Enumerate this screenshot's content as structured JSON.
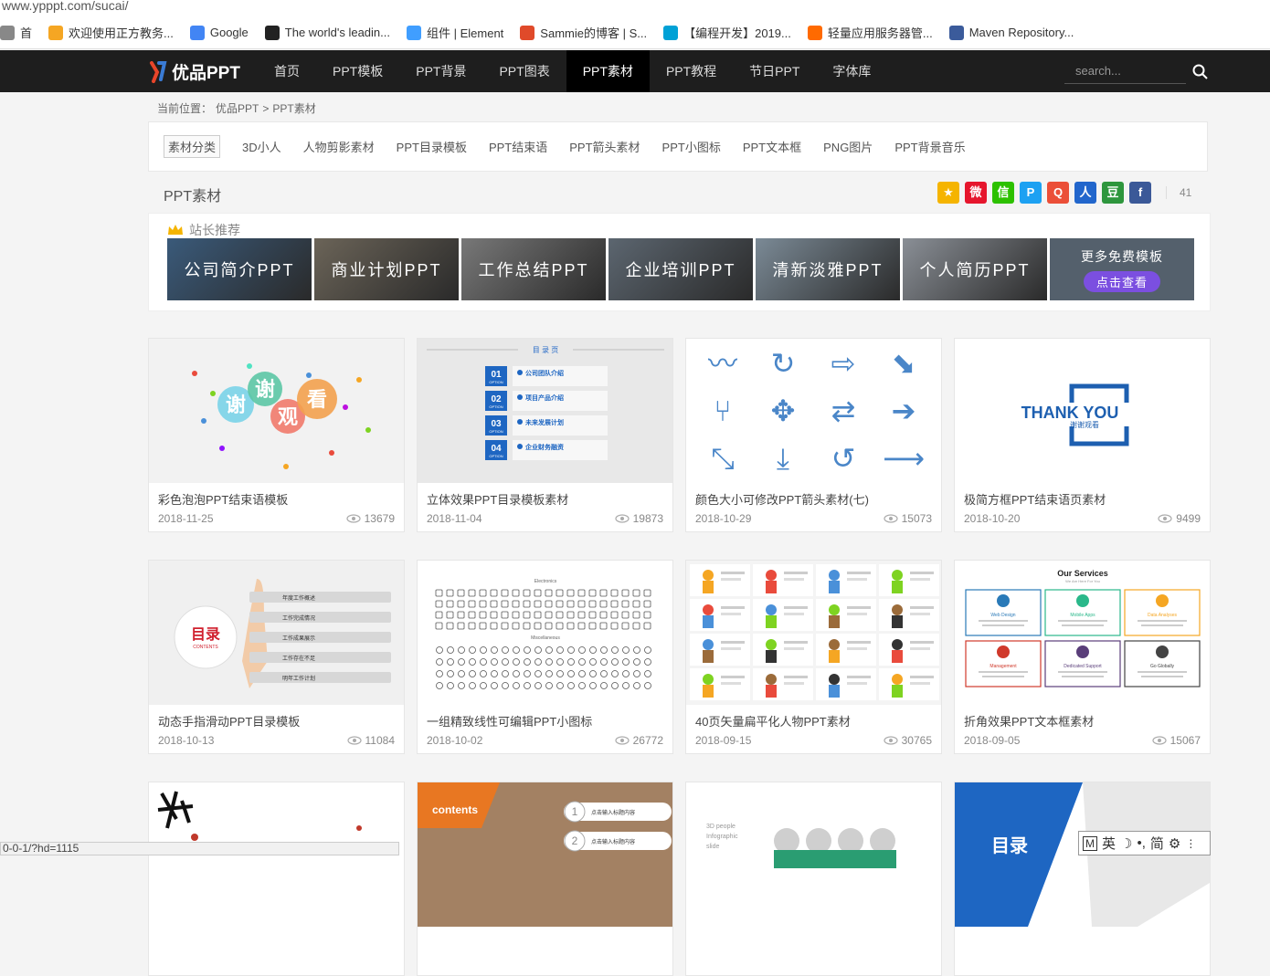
{
  "browser": {
    "url": "www.ypppt.com/sucai/",
    "bookmarks": [
      {
        "label": "首",
        "icon": "page-icon",
        "color": "#888888"
      },
      {
        "label": "欢迎使用正方教务...",
        "icon": "ep-icon",
        "color": "#f5a623"
      },
      {
        "label": "Google",
        "icon": "google-icon",
        "color": "#4285f4"
      },
      {
        "label": "The world's leadin...",
        "icon": "github-icon",
        "color": "#222222"
      },
      {
        "label": "组件 | Element",
        "icon": "element-icon",
        "color": "#409eff"
      },
      {
        "label": "Sammie的博客 | S...",
        "icon": "tomato-icon",
        "color": "#e04a2a"
      },
      {
        "label": "【编程开发】2019...",
        "icon": "bilibili-icon",
        "color": "#00a1d6"
      },
      {
        "label": "轻量应用服务器管...",
        "icon": "aliyun-icon",
        "color": "#ff6a00"
      },
      {
        "label": "Maven Repository...",
        "icon": "maven-icon",
        "color": "#3b5b9b"
      }
    ],
    "status_url": "0-0-1/?hd=1115"
  },
  "site": {
    "logo_text": "优品PPT",
    "nav": [
      "首页",
      "PPT模板",
      "PPT背景",
      "PPT图表",
      "PPT素材",
      "PPT教程",
      "节日PPT",
      "字体库"
    ],
    "active_nav": 4,
    "search_placeholder": "search..."
  },
  "breadcrumb": {
    "prefix": "当前位置：",
    "home": "优品PPT",
    "sep": ">",
    "current": "PPT素材"
  },
  "categories": [
    "素材分类",
    "3D小人",
    "人物剪影素材",
    "PPT目录模板",
    "PPT结束语",
    "PPT箭头素材",
    "PPT小图标",
    "PPT文本框",
    "PNG图片",
    "PPT背景音乐"
  ],
  "section_title": "PPT素材",
  "share": {
    "icons": [
      {
        "name": "qzone-icon",
        "color": "#f5b400",
        "glyph": "★"
      },
      {
        "name": "weibo-icon",
        "color": "#e6162d",
        "glyph": "微"
      },
      {
        "name": "wechat-icon",
        "color": "#2dc100",
        "glyph": "信"
      },
      {
        "name": "tqq-icon",
        "color": "#1da1f2",
        "glyph": "P"
      },
      {
        "name": "qq-icon",
        "color": "#eb4f38",
        "glyph": "Q"
      },
      {
        "name": "renren-icon",
        "color": "#2266cc",
        "glyph": "人"
      },
      {
        "name": "douban-icon",
        "color": "#2e963d",
        "glyph": "豆"
      },
      {
        "name": "facebook-icon",
        "color": "#3b5998",
        "glyph": "f"
      }
    ],
    "count": "41"
  },
  "recommend": {
    "title": "站长推荐",
    "banners": [
      {
        "label": "公司简介PPT",
        "color": "#3a5a7a"
      },
      {
        "label": "商业计划PPT",
        "color": "#6b6458"
      },
      {
        "label": "工作总结PPT",
        "color": "#787878"
      },
      {
        "label": "企业培训PPT",
        "color": "#5c6670"
      },
      {
        "label": "清新淡雅PPT",
        "color": "#7b8a96"
      },
      {
        "label": "个人简历PPT",
        "color": "#8a8f96"
      }
    ],
    "more": {
      "label": "更多免费模板",
      "button": "点击查看",
      "color": "#54606c"
    }
  },
  "items": [
    {
      "title": "彩色泡泡PPT结束语模板",
      "date": "2018-11-25",
      "views": "13679",
      "thumb": "bubbles"
    },
    {
      "title": "立体效果PPT目录模板素材",
      "date": "2018-11-04",
      "views": "19873",
      "thumb": "toc"
    },
    {
      "title": "颜色大小可修改PPT箭头素材(七)",
      "date": "2018-10-29",
      "views": "15073",
      "thumb": "arrows"
    },
    {
      "title": "极简方框PPT结束语页素材",
      "date": "2018-10-20",
      "views": "9499",
      "thumb": "thankyou"
    },
    {
      "title": "动态手指滑动PPT目录模板",
      "date": "2018-10-13",
      "views": "11084",
      "thumb": "finger"
    },
    {
      "title": "一组精致线性可编辑PPT小图标",
      "date": "2018-10-02",
      "views": "26772",
      "thumb": "icons"
    },
    {
      "title": "40页矢量扁平化人物PPT素材",
      "date": "2018-09-15",
      "views": "30765",
      "thumb": "people"
    },
    {
      "title": "折角效果PPT文本框素材",
      "date": "2018-09-05",
      "views": "15067",
      "thumb": "services"
    },
    {
      "title": "",
      "date": "",
      "views": "",
      "thumb": "calligraphy"
    },
    {
      "title": "",
      "date": "",
      "views": "",
      "thumb": "contents"
    },
    {
      "title": "",
      "date": "",
      "views": "",
      "thumb": "team"
    },
    {
      "title": "",
      "date": "",
      "views": "",
      "thumb": "mulu"
    }
  ],
  "thumb_text": {
    "bubbles": [
      "谢",
      "谢",
      "观",
      "看"
    ],
    "toc_header": "目 录 页",
    "toc_items": [
      {
        "num": "01",
        "label": "公司团队介绍"
      },
      {
        "num": "02",
        "label": "项目产品介绍"
      },
      {
        "num": "03",
        "label": "未来发展计划"
      },
      {
        "num": "04",
        "label": "企业财务融资"
      }
    ],
    "toc_option": "OPTION",
    "thankyou_main": "THANK YOU",
    "thankyou_sub": "谢谢观看",
    "finger_title": "目录",
    "finger_sub": "CONTENTS",
    "finger_items": [
      "年度工作概述",
      "工作完成情况",
      "工作成果展示",
      "工作存在不足",
      "明年工作计划"
    ],
    "icons_header1": "Electronics",
    "icons_header2": "Miscellaneous",
    "services_title": "Our Services",
    "services_sub": "We Are Here For You",
    "services": [
      "Web Design",
      "Mobile Apps",
      "Data Analyses",
      "Management",
      "Dedicated Support",
      "Go Globally"
    ],
    "contents_label": "contents",
    "contents_items": [
      {
        "num": "1",
        "label": "点击输入标题内容"
      },
      {
        "num": "2",
        "label": "点击输入标题内容"
      }
    ],
    "team_caption": [
      "3D people",
      "Infographic",
      "slide"
    ],
    "mulu_title": "目录"
  },
  "ime": {
    "label": "英",
    "mode": "简"
  }
}
